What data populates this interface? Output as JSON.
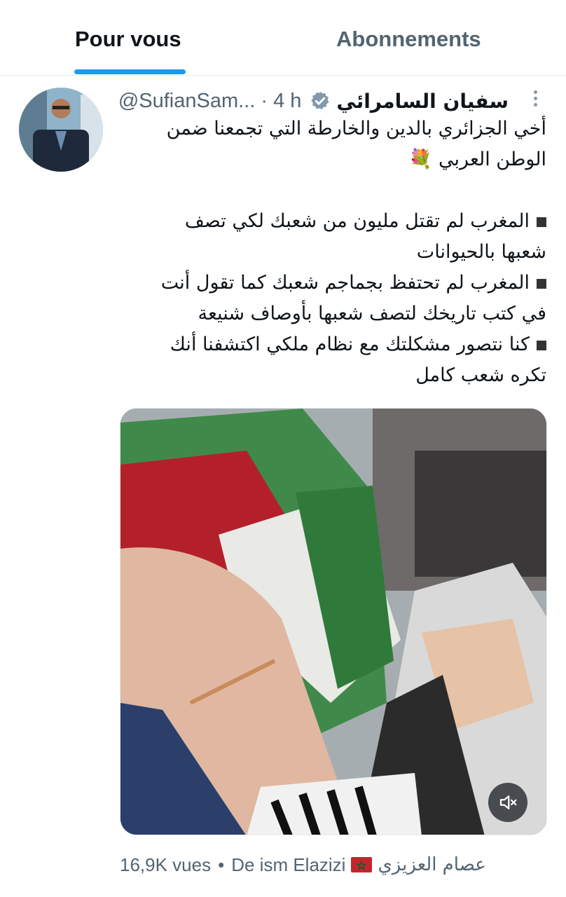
{
  "tabs": [
    {
      "label": "Pour vous",
      "active": true
    },
    {
      "label": "Abonnements",
      "active": false
    }
  ],
  "tweet": {
    "display_name": "سفيان السامرائي",
    "handle": "@SufianSam...",
    "separator": "·",
    "time": "4 h",
    "verified_icon": "verified-badge-icon",
    "lines": [
      "أخي الجزائري بالدين والخارطة التي تجمعنا ضمن",
      "الوطن العربي 💐",
      "",
      "المغرب لم تقتل مليون من شعبك لكي تصف",
      "شعبها بالحيوانات",
      "المغرب لم تحتفظ بجماجم شعبك كما تقول أنت",
      "في كتب تاريخك لتصف شعبها بأوصاف شنيعة",
      "كنا نتصور مشكلتك مع نظام ملكي اكتشفنا أنك",
      "تكره شعب كامل"
    ],
    "bullet_line_indexes": [
      3,
      5,
      7
    ],
    "media": {
      "type": "video",
      "muted": true,
      "mute_icon": "speaker-muted-icon"
    },
    "views": "16,9K vues",
    "dot": "•",
    "source_prefix": "De ism Elazizi",
    "source_flag_icon": "morocco-flag-icon",
    "source_name": "عصام العزيزي"
  },
  "colors": {
    "accent": "#1d9bf0",
    "muted_text": "#536471",
    "text": "#0f1419"
  }
}
